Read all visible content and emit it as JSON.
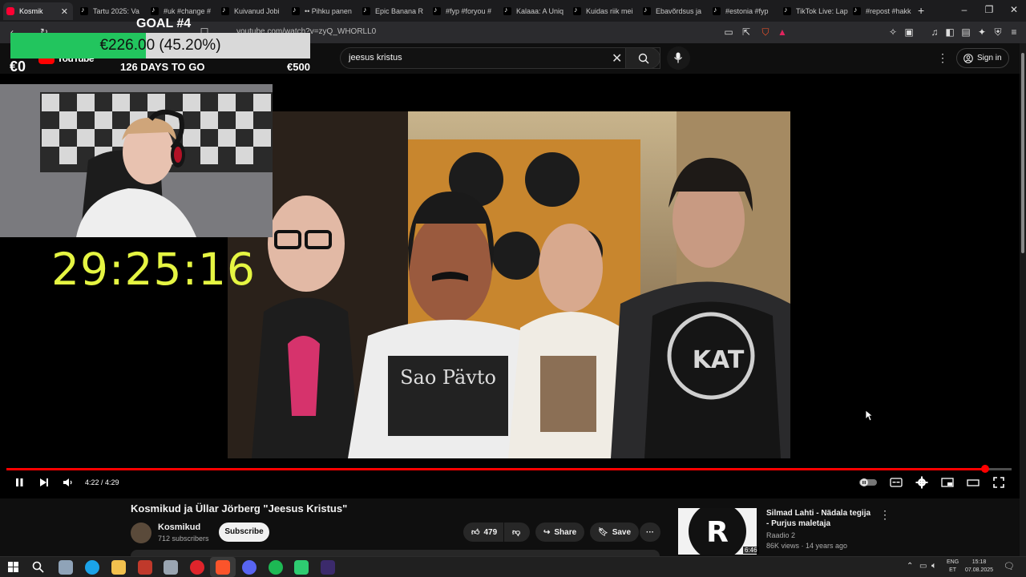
{
  "browser": {
    "tabs": [
      {
        "label": "Kosmik",
        "icon": "youtube-icon",
        "active": true
      },
      {
        "label": "Tartu 2025: Va",
        "icon": "tiktok-icon"
      },
      {
        "label": "#uk #change #",
        "icon": "tiktok-icon"
      },
      {
        "label": "Kuivanud Jobi",
        "icon": "tiktok-icon"
      },
      {
        "label": "•• Pihku panen",
        "icon": "tiktok-icon"
      },
      {
        "label": "Epic Banana R",
        "icon": "tiktok-icon"
      },
      {
        "label": "#fyp #foryou #",
        "icon": "tiktok-icon"
      },
      {
        "label": "Kalaaa: A Uniq",
        "icon": "tiktok-icon"
      },
      {
        "label": "Kuidas riik mei",
        "icon": "tiktok-icon"
      },
      {
        "label": "Ebavõrdsus ja",
        "icon": "tiktok-icon"
      },
      {
        "label": "#estonia #fyp",
        "icon": "tiktok-icon"
      },
      {
        "label": "TikTok Live: Lap",
        "icon": "tiktok-icon"
      },
      {
        "label": "#repost #hakk",
        "icon": "tiktok-icon"
      }
    ],
    "new_tab": "+",
    "url": "youtube.com/watch?v=zyQ_WHORLL0"
  },
  "youtube": {
    "logo": "YouTube",
    "search_query": "jeesus kristus",
    "sign_in": "Sign in"
  },
  "stream_overlay": {
    "goal_title": "GOAL #4",
    "goal_amount": "€226.00 (45.20%)",
    "goal_progress": 0.452,
    "goal_min": "€0",
    "goal_max": "€500",
    "days_to_go": "126 DAYS TO GO",
    "countdown": "29:25:16"
  },
  "player": {
    "time": "4:22 / 4:29",
    "progress": 0.974,
    "shirt_text": "Sao Pävto",
    "shirt_text_2": "KAT"
  },
  "video": {
    "title": "Kosmikud ja Üllar Jörberg \"Jeesus Kristus\"",
    "channel": "Kosmikud",
    "subscribers": "712 subscribers",
    "subscribe": "Subscribe",
    "likes": "479",
    "share": "Share",
    "save": "Save"
  },
  "recommendation": {
    "title": "Silmad Lahti - Nädala tegija - Purjus maletaja",
    "channel": "Raadio 2",
    "meta": "86K views · 14 years ago",
    "duration": "6:46",
    "thumb_letter": "R"
  },
  "taskbar": {
    "lang_top": "ENG",
    "lang_bottom": "ET",
    "time": "15:18",
    "date": "07.08.2025"
  },
  "colors": {
    "progress_red": "#ff0000",
    "goal_green": "#22c55e",
    "countdown_yellow": "#e5f542"
  }
}
